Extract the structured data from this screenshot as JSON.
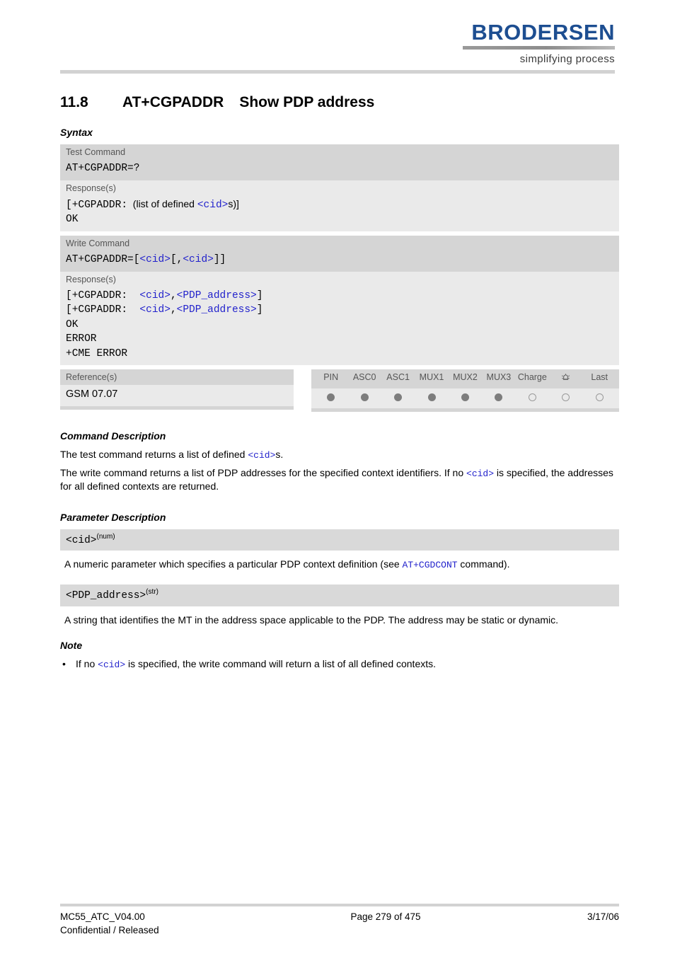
{
  "header": {
    "logo_word": "BRODERSEN",
    "logo_tagline": "simplifying process",
    "logo_color": "#1d4e91"
  },
  "section": {
    "number": "11.8",
    "command": "AT+CGPADDR",
    "title": "Show PDP address"
  },
  "syntax": {
    "heading": "Syntax",
    "test_command": {
      "label": "Test Command",
      "code": "AT+CGPADDR=?",
      "response_label": "Response(s)",
      "response_line1_prefix": "[+CGPADDR:",
      "response_line1_text": "(list of defined ",
      "response_line1_param": "<cid>",
      "response_line1_suffix": "s)]",
      "response_line2": "OK"
    },
    "write_command": {
      "label": "Write Command",
      "code_prefix": "AT+CGPADDR=[",
      "code_param1": "<cid>",
      "code_mid": "[,",
      "code_param2": "<cid>",
      "code_suffix": "]]",
      "response_label": "Response(s)",
      "resp_line_prefix": "[+CGPADDR:  ",
      "resp_param_cid": "<cid>",
      "resp_comma": ",",
      "resp_param_pdp": "<PDP_address>",
      "resp_line_suffix": "]",
      "resp_ok": "OK",
      "resp_error": "ERROR",
      "resp_cme": "+CME ERROR"
    },
    "reference": {
      "label": "Reference(s)",
      "value": "GSM 07.07"
    },
    "capabilities": {
      "columns": [
        {
          "label": "PIN",
          "state": "filled"
        },
        {
          "label": "ASC0",
          "state": "filled"
        },
        {
          "label": "ASC1",
          "state": "filled"
        },
        {
          "label": "MUX1",
          "state": "filled"
        },
        {
          "label": "MUX2",
          "state": "filled"
        },
        {
          "label": "MUX3",
          "state": "filled"
        },
        {
          "label": "Charge",
          "state": "open"
        },
        {
          "label": "alarm-bell-icon",
          "state": "open",
          "is_icon": true
        },
        {
          "label": "Last",
          "state": "open"
        }
      ]
    }
  },
  "command_description": {
    "heading": "Command Description",
    "para1_a": "The test command returns a list of defined ",
    "para1_param": "<cid>",
    "para1_b": "s.",
    "para2_a": "The write command returns a list of PDP addresses for the specified context identifiers. If no ",
    "para2_param": "<cid>",
    "para2_b": " is specified, the addresses for all defined contexts are returned."
  },
  "parameter_description": {
    "heading": "Parameter Description",
    "params": [
      {
        "name": "<cid>",
        "type": "(num)",
        "desc_a": "A numeric parameter which specifies a particular PDP context definition (see ",
        "desc_link": "AT+CGDCONT",
        "desc_b": " command)."
      },
      {
        "name": "<PDP_address>",
        "type": "(str)",
        "desc_a": "A string that identifies the MT in the address space applicable to the PDP. The address may be static or dynamic.",
        "desc_link": "",
        "desc_b": ""
      }
    ]
  },
  "note": {
    "heading": "Note",
    "bullet": "•",
    "item_a": "If no ",
    "item_param": "<cid>",
    "item_b": " is specified, the write command will return a list of all defined contexts."
  },
  "footer": {
    "doc_id": "MC55_ATC_V04.00",
    "classification": "Confidential / Released",
    "page": "Page 279 of 475",
    "date": "3/17/06"
  },
  "colors": {
    "param_blue": "#2222cc",
    "band_dark": "#d5d5d5",
    "band_light": "#eaeaea",
    "rule_gray": "#d2d2d2"
  }
}
